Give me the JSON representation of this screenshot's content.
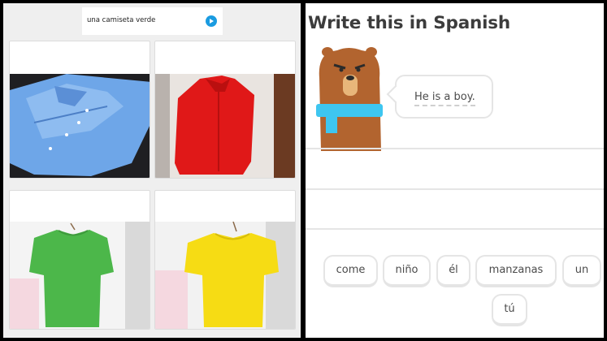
{
  "left_panel": {
    "prompt": {
      "text": "una camiseta verde",
      "icon": "play-icon",
      "icon_color": "#1a9be0"
    },
    "options": [
      {
        "icon": "blue-shirt-image",
        "color": "#5f9be0"
      },
      {
        "icon": "red-shirt-image",
        "color": "#e01818"
      },
      {
        "icon": "green-tshirt-image",
        "color": "#4cb74a"
      },
      {
        "icon": "yellow-tshirt-image",
        "color": "#f6dc14"
      }
    ]
  },
  "right_panel": {
    "title": "Write this in Spanish",
    "character": {
      "icon": "bear-character-icon",
      "fur_color": "#b2642f",
      "scarf_color": "#3ec6f0"
    },
    "speech": "He is a boy.",
    "word_bank": [
      "come",
      "niño",
      "él",
      "manzanas",
      "un",
      "tú"
    ]
  }
}
